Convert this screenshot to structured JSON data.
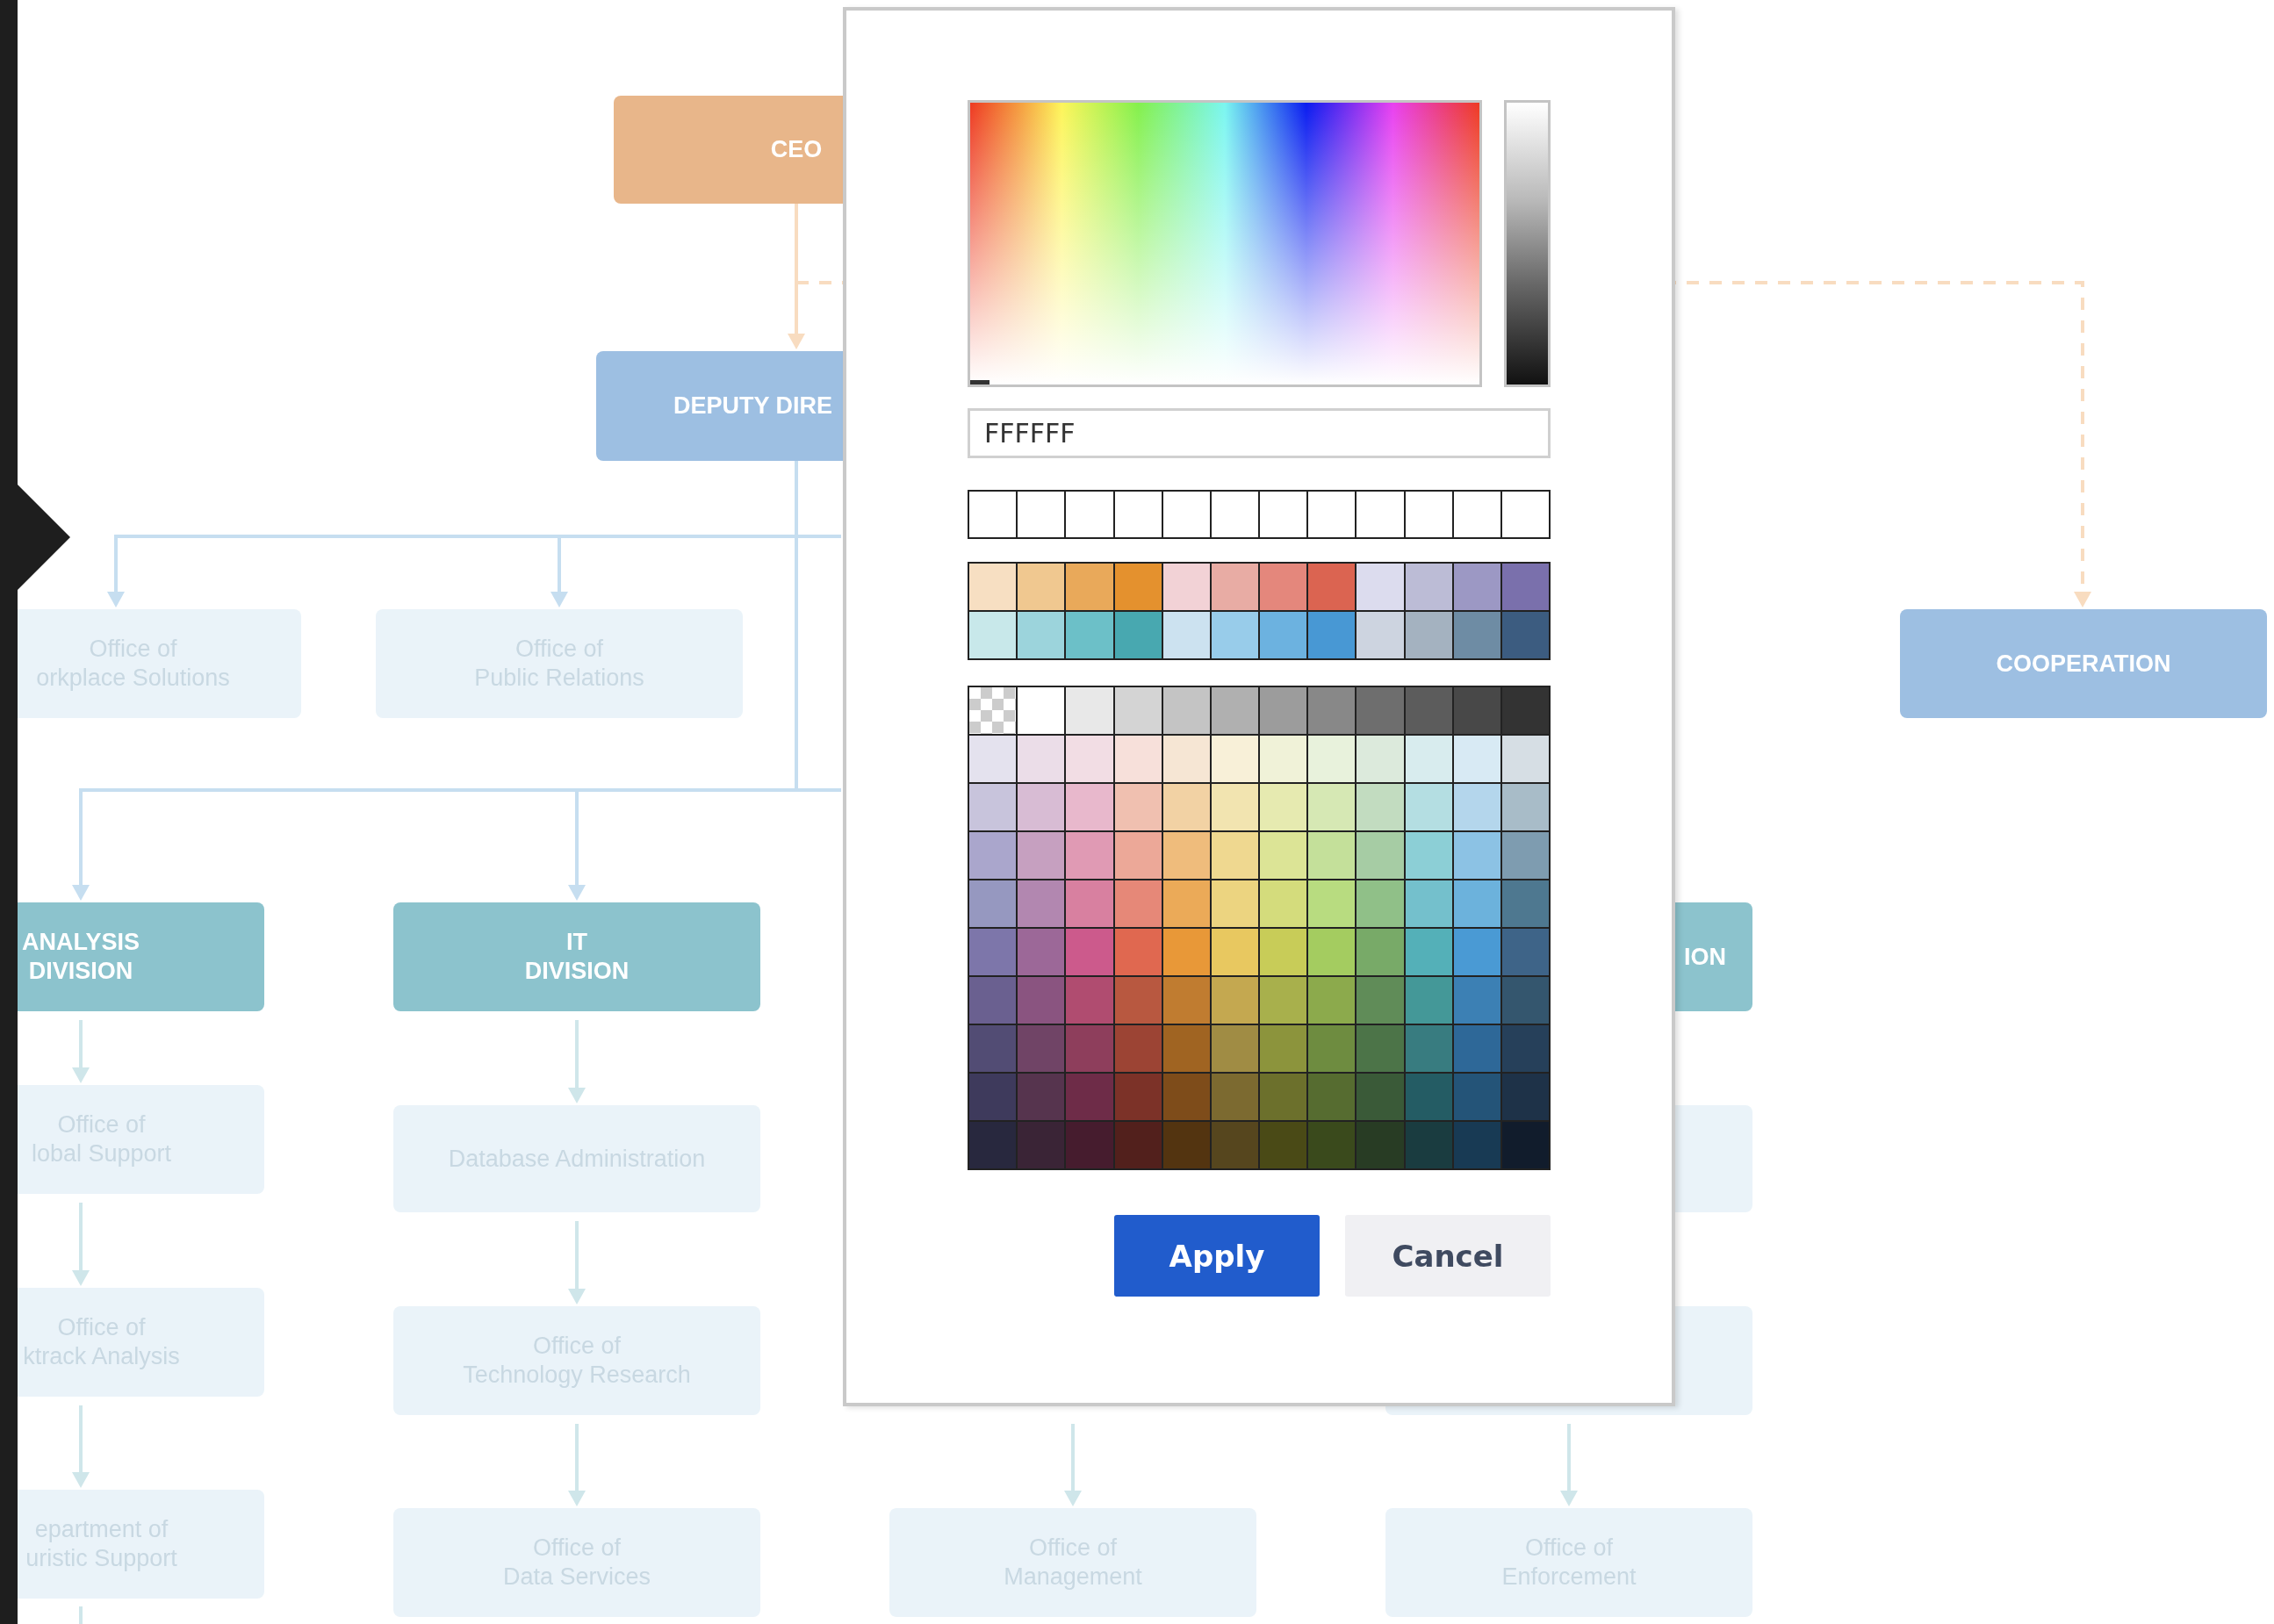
{
  "org_chart": {
    "nodes": [
      {
        "kind": "executive",
        "lines": [
          "CEO"
        ]
      },
      {
        "kind": "department",
        "lines": [
          "DEPUTY DIRE"
        ]
      },
      {
        "kind": "office",
        "lines": [
          "Office of",
          "orkplace Solutions"
        ]
      },
      {
        "kind": "office",
        "lines": [
          "Office of",
          "Public Relations"
        ]
      },
      {
        "kind": "department",
        "lines": [
          "COOPERATION"
        ]
      },
      {
        "kind": "division",
        "lines": [
          "ANALYSIS",
          "DIVISION"
        ]
      },
      {
        "kind": "division",
        "lines": [
          "IT",
          "DIVISION"
        ]
      },
      {
        "kind": "division",
        "lines": [
          "ION"
        ]
      },
      {
        "kind": "office",
        "lines": [
          "Office of",
          "lobal Support"
        ]
      },
      {
        "kind": "office",
        "lines": [
          "Database Administration"
        ]
      },
      {
        "kind": "office"
      },
      {
        "kind": "office",
        "lines": [
          "Office of",
          "ktrack Analysis"
        ]
      },
      {
        "kind": "office",
        "lines": [
          "Office of",
          "Technology Research"
        ]
      },
      {
        "kind": "office"
      },
      {
        "kind": "office",
        "lines": [
          "epartment of",
          "uristic Support"
        ]
      },
      {
        "kind": "office",
        "lines": [
          "Office of",
          "Data Services"
        ]
      },
      {
        "kind": "office",
        "lines": [
          "Office of",
          "Management"
        ]
      },
      {
        "kind": "office",
        "lines": [
          "Office of",
          "Enforcement"
        ]
      }
    ]
  },
  "color_picker": {
    "hex_value": "FFFFFF",
    "brightness": {
      "level": 1
    },
    "recent": [
      {
        "color": "#ffffff"
      },
      {
        "color": "#ffffff"
      },
      {
        "color": "#ffffff"
      },
      {
        "color": "#ffffff"
      },
      {
        "color": "#ffffff"
      },
      {
        "color": "#ffffff"
      },
      {
        "color": "#ffffff"
      },
      {
        "color": "#ffffff"
      },
      {
        "color": "#ffffff"
      },
      {
        "color": "#ffffff"
      },
      {
        "color": "#ffffff"
      },
      {
        "color": "#ffffff"
      }
    ],
    "theme": [
      [
        {
          "color": "#f7dfc2"
        },
        {
          "color": "#f0c890"
        },
        {
          "color": "#e9a95a"
        },
        {
          "color": "#e4912e"
        },
        {
          "color": "#f2d2d6"
        },
        {
          "color": "#e8aca4"
        },
        {
          "color": "#e4877c"
        },
        {
          "color": "#db6451"
        },
        {
          "color": "#dcdcee"
        },
        {
          "color": "#bcbcd6"
        },
        {
          "color": "#9c98c4"
        },
        {
          "color": "#7a70ac"
        }
      ],
      [
        {
          "color": "#c8e8ea"
        },
        {
          "color": "#9cd4dc"
        },
        {
          "color": "#6cc0c8"
        },
        {
          "color": "#48a8b0"
        },
        {
          "color": "#cce2f0"
        },
        {
          "color": "#98ccea"
        },
        {
          "color": "#6cb2e0"
        },
        {
          "color": "#4898d4"
        },
        {
          "color": "#cdd4e0"
        },
        {
          "color": "#a4b2c0"
        },
        {
          "color": "#6e8ca4"
        },
        {
          "color": "#3c5c80"
        }
      ]
    ],
    "grid": [
      [
        {
          "kind": "transparent"
        },
        {
          "color": "#ffffff"
        },
        {
          "color": "#e8e8e8"
        },
        {
          "color": "#d4d4d4"
        },
        {
          "color": "#c4c4c4"
        },
        {
          "color": "#b0b0b0"
        },
        {
          "color": "#9c9c9c"
        },
        {
          "color": "#888888"
        },
        {
          "color": "#6e6e6e"
        },
        {
          "color": "#5c5c5c"
        },
        {
          "color": "#484848"
        },
        {
          "color": "#333333"
        }
      ],
      [
        {
          "color": "#e4e2ee"
        },
        {
          "color": "#ebdde8"
        },
        {
          "color": "#f2dde4"
        },
        {
          "color": "#f7e0da"
        },
        {
          "color": "#f6e6d4"
        },
        {
          "color": "#f8f0d8"
        },
        {
          "color": "#f0f2d8"
        },
        {
          "color": "#e8f2dc"
        },
        {
          "color": "#dceadc"
        },
        {
          "color": "#d8ecee"
        },
        {
          "color": "#d8eaf4"
        },
        {
          "color": "#d6dee4"
        }
      ],
      [
        {
          "color": "#c8c4dc"
        },
        {
          "color": "#d8bcd4"
        },
        {
          "color": "#e8b8cc"
        },
        {
          "color": "#f0c0b0"
        },
        {
          "color": "#f2d2a4"
        },
        {
          "color": "#f2e4b0"
        },
        {
          "color": "#e6eab0"
        },
        {
          "color": "#d6e8b4"
        },
        {
          "color": "#c2dcc0"
        },
        {
          "color": "#b4dee2"
        },
        {
          "color": "#b4d6ec"
        },
        {
          "color": "#a8bcc8"
        }
      ],
      [
        {
          "color": "#aaa6cc"
        },
        {
          "color": "#c6a0c0"
        },
        {
          "color": "#e09ab4"
        },
        {
          "color": "#eca898"
        },
        {
          "color": "#efbc7c"
        },
        {
          "color": "#efd890"
        },
        {
          "color": "#dce496"
        },
        {
          "color": "#c4e09a"
        },
        {
          "color": "#a6cca4"
        },
        {
          "color": "#8ccfd6"
        },
        {
          "color": "#8cc2e4"
        },
        {
          "color": "#7e9cb0"
        }
      ],
      [
        {
          "color": "#9698c0"
        },
        {
          "color": "#b287b0"
        },
        {
          "color": "#d880a0"
        },
        {
          "color": "#e68878"
        },
        {
          "color": "#ebaa58"
        },
        {
          "color": "#ecd480"
        },
        {
          "color": "#d4dc7c"
        },
        {
          "color": "#b8dc80"
        },
        {
          "color": "#90c088"
        },
        {
          "color": "#74c0cc"
        },
        {
          "color": "#6cb2dc"
        },
        {
          "color": "#4e7890"
        }
      ],
      [
        {
          "color": "#7d76aa"
        },
        {
          "color": "#9c6898"
        },
        {
          "color": "#cc5a8c"
        },
        {
          "color": "#e06850"
        },
        {
          "color": "#e89838"
        },
        {
          "color": "#e8c860"
        },
        {
          "color": "#c8cc58"
        },
        {
          "color": "#a4cc60"
        },
        {
          "color": "#78aa68"
        },
        {
          "color": "#54b0b8"
        },
        {
          "color": "#4a9ad4"
        },
        {
          "color": "#3e6488"
        }
      ],
      [
        {
          "color": "#6a6090"
        },
        {
          "color": "#8a5480"
        },
        {
          "color": "#b04c70"
        },
        {
          "color": "#b85840"
        },
        {
          "color": "#c07c30"
        },
        {
          "color": "#c4a850"
        },
        {
          "color": "#a8b04c"
        },
        {
          "color": "#8caa4c"
        },
        {
          "color": "#608c58"
        },
        {
          "color": "#449898"
        },
        {
          "color": "#3c80b4"
        },
        {
          "color": "#34566e"
        }
      ],
      [
        {
          "color": "#524c74"
        },
        {
          "color": "#704466"
        },
        {
          "color": "#8e3e5c"
        },
        {
          "color": "#9c4434"
        },
        {
          "color": "#a06422"
        },
        {
          "color": "#a08c44"
        },
        {
          "color": "#8c943c"
        },
        {
          "color": "#6e8c40"
        },
        {
          "color": "#4c7448"
        },
        {
          "color": "#387c80"
        },
        {
          "color": "#2e6898"
        },
        {
          "color": "#26405a"
        }
      ],
      [
        {
          "color": "#3e3a5c"
        },
        {
          "color": "#56344e"
        },
        {
          "color": "#6e2c48"
        },
        {
          "color": "#7c3228"
        },
        {
          "color": "#7e4c1a"
        },
        {
          "color": "#7c6a30"
        },
        {
          "color": "#6c702c"
        },
        {
          "color": "#566c30"
        },
        {
          "color": "#3a5a38"
        },
        {
          "color": "#245c64"
        },
        {
          "color": "#245478"
        },
        {
          "color": "#1e3248"
        }
      ],
      [
        {
          "color": "#28283e"
        },
        {
          "color": "#3a2436"
        },
        {
          "color": "#461c2e"
        },
        {
          "color": "#52201c"
        },
        {
          "color": "#533410"
        },
        {
          "color": "#56461e"
        },
        {
          "color": "#4a4a16"
        },
        {
          "color": "#3a4a1c"
        },
        {
          "color": "#283c24"
        },
        {
          "color": "#1a3c40"
        },
        {
          "color": "#183a54"
        },
        {
          "color": "#111c2c"
        }
      ]
    ],
    "buttons": [
      {
        "kind": "primary",
        "label": "Apply"
      },
      {
        "kind": "secondary",
        "label": "Cancel"
      }
    ]
  }
}
